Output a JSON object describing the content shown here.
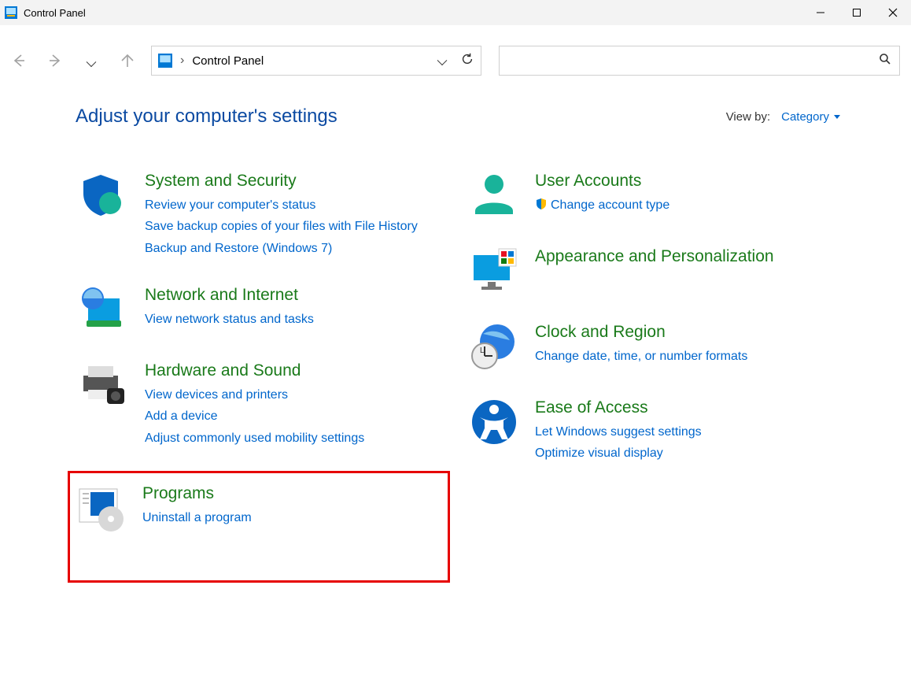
{
  "window": {
    "title": "Control Panel"
  },
  "address": {
    "crumb": "Control Panel"
  },
  "search": {
    "placeholder": ""
  },
  "header": {
    "heading": "Adjust your computer's settings",
    "viewby_label": "View by:",
    "viewby_value": "Category"
  },
  "left": [
    {
      "name": "system-security",
      "title": "System and Security",
      "links": [
        "Review your computer's status",
        "Save backup copies of your files with File History",
        "Backup and Restore (Windows 7)"
      ]
    },
    {
      "name": "network-internet",
      "title": "Network and Internet",
      "links": [
        "View network status and tasks"
      ]
    },
    {
      "name": "hardware-sound",
      "title": "Hardware and Sound",
      "links": [
        "View devices and printers",
        "Add a device",
        "Adjust commonly used mobility settings"
      ]
    },
    {
      "name": "programs",
      "title": "Programs",
      "links": [
        "Uninstall a program"
      ],
      "highlighted": true
    }
  ],
  "right": [
    {
      "name": "user-accounts",
      "title": "User Accounts",
      "links": [
        "Change account type"
      ],
      "shield_on": [
        0
      ]
    },
    {
      "name": "appearance",
      "title": "Appearance and Personalization",
      "links": []
    },
    {
      "name": "clock-region",
      "title": "Clock and Region",
      "links": [
        "Change date, time, or number formats"
      ]
    },
    {
      "name": "ease-of-access",
      "title": "Ease of Access",
      "links": [
        "Let Windows suggest settings",
        "Optimize visual display"
      ]
    }
  ]
}
